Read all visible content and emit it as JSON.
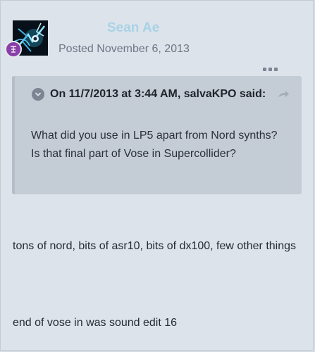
{
  "post": {
    "author": "Sean Ae",
    "posted": "Posted November 6, 2013",
    "avatar_icon": "abstract-avatar-image",
    "badge_icon": "rank-badge-icon",
    "more_icon": "ellipsis-icon"
  },
  "quote": {
    "citation": "On 11/7/2013 at 3:44 AM, salvaKPO said:",
    "toggle_icon": "chevron-down-icon",
    "link_icon": "share-arrow-icon",
    "body": "What did you use in LP5 apart from Nord synths? Is that final part of Vose in Supercollider?"
  },
  "content": {
    "paragraph_1": "tons of nord, bits of asr10, bits of dx100, few other things",
    "paragraph_2": "end of vose in was sound edit 16"
  },
  "colors": {
    "author_name": "#a7d3e6",
    "badge": "#8a3fa8",
    "quote_background": "#c4ccd6",
    "post_background": "#dde3ea"
  }
}
